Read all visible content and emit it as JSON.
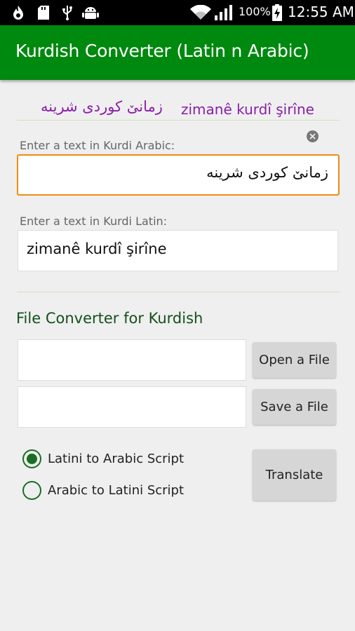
{
  "status_bar": {
    "battery_percent": "100%",
    "time": "12:55 AM",
    "icons": [
      "flame-icon",
      "sd-card-icon",
      "usb-icon",
      "android-debug-icon",
      "wifi-icon",
      "signal-icon",
      "battery-charging-icon"
    ]
  },
  "app_bar": {
    "title": "Kurdish Converter (Latin n Arabic)"
  },
  "samples": {
    "arabic": "زمانێ کوردی شرینە",
    "latin": "zimanê kurdî şirîne"
  },
  "arabic_input": {
    "label": "Enter a text in Kurdi Arabic:",
    "value": "زمانێ کوردی شرینە"
  },
  "latin_input": {
    "label": "Enter a text in Kurdi Latin:",
    "value": "zimanê kurdî şirîne"
  },
  "file_converter": {
    "title": "File Converter for Kurdish",
    "open_path_value": "",
    "save_path_value": "",
    "open_button": "Open a File",
    "save_button": "Save a File"
  },
  "direction": {
    "options": [
      {
        "label": "Latini to Arabic Script",
        "selected": true
      },
      {
        "label": "Arabic to Latini Script",
        "selected": false
      }
    ]
  },
  "translate_button": "Translate",
  "colors": {
    "app_bar": "#00890f",
    "sample_text": "#8a1fa8",
    "focus_border": "#f08b12",
    "radio": "#1a6d22"
  }
}
